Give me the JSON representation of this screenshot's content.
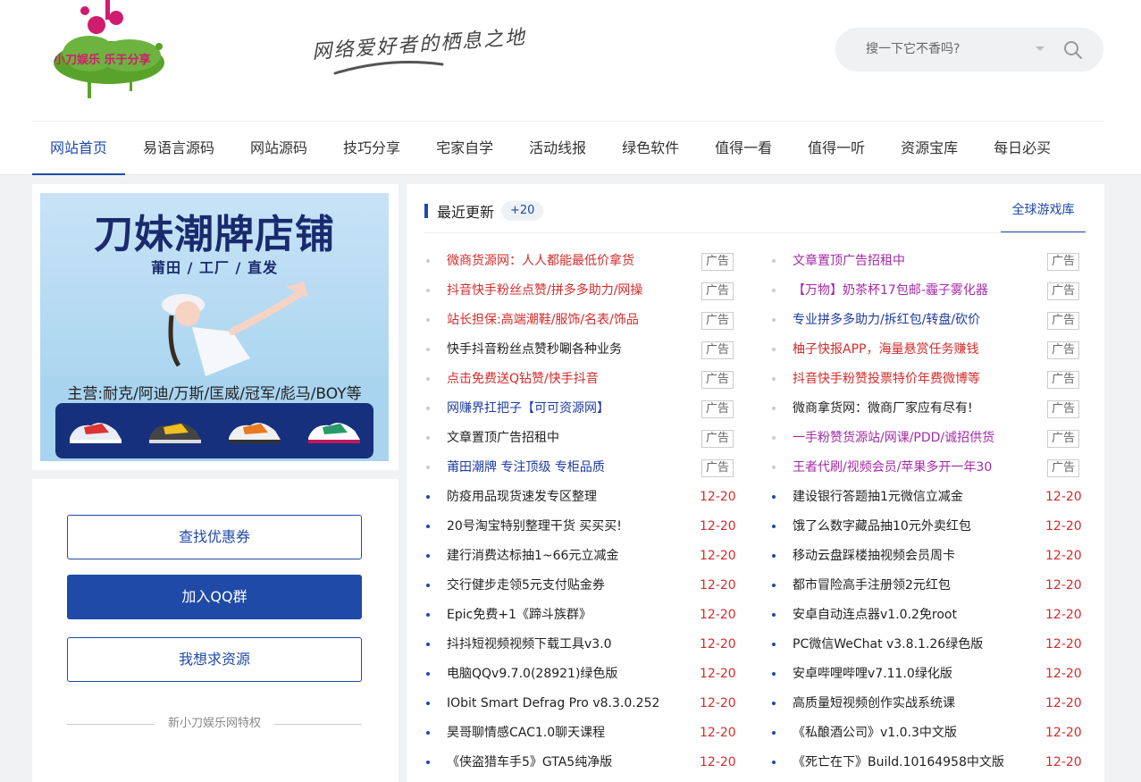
{
  "header": {
    "logo_text": "小刀娱乐 乐于分享",
    "slogan": "网络爱好者的栖息之地",
    "search_placeholder": "搜一下它不香吗?"
  },
  "nav": {
    "items": [
      "网站首页",
      "易语言源码",
      "网站源码",
      "技巧分享",
      "宅家自学",
      "活动线报",
      "绿色软件",
      "值得一看",
      "值得一听",
      "资源宝库",
      "每日必买"
    ],
    "active_index": 0
  },
  "ad": {
    "title": "刀妹潮牌店铺",
    "subtitle": "莆田 / 工厂 / 直发",
    "main_text": "主营:耐克/阿迪/万斯/匡威/冠军/彪马/BOY等"
  },
  "sidebar": {
    "buttons": [
      "查找优惠券",
      "加入QQ群",
      "我想求资源"
    ],
    "footer_text": "新小刀娱乐网特权"
  },
  "main": {
    "section_title": "最近更新",
    "badge": "+20",
    "right_tab": "全球游戏库",
    "ad_label": "广告",
    "left_ads": [
      {
        "text": "微商货源网：人人都能最低价拿货",
        "color": "red"
      },
      {
        "text": "抖音快手粉丝点赞/拼多多助力/网操",
        "color": "red"
      },
      {
        "text": "站长担保:高端潮鞋/服饰/名表/饰品",
        "color": "red"
      },
      {
        "text": "快手抖音粉丝点赞秒唰各种业务",
        "color": "dark"
      },
      {
        "text": "点击免费送Q钻赞/快手抖音",
        "color": "red"
      },
      {
        "text": "网赚界扛把子【可可资源网】",
        "color": "blue"
      },
      {
        "text": "文章置顶广告招租中",
        "color": "dark"
      },
      {
        "text": "莆田潮牌 专注顶级 专柜品质",
        "color": "blue"
      }
    ],
    "right_ads": [
      {
        "text": "文章置顶广告招租中",
        "color": "purple"
      },
      {
        "text": "【万物】奶茶杯17包邮-霾子雾化器",
        "color": "purple"
      },
      {
        "text": "专业拼多多助力/拆红包/转盘/砍价",
        "color": "blue"
      },
      {
        "text": "柚子快报APP，海量悬赏任务赚钱",
        "color": "red"
      },
      {
        "text": "抖音快手粉赞投票特价年费微博等",
        "color": "red"
      },
      {
        "text": "微商拿货网：微商厂家应有尽有!",
        "color": "dark"
      },
      {
        "text": "一手粉赞货源站/网课/PDD/诚招供货",
        "color": "purple"
      },
      {
        "text": "王者代刷/视频会员/苹果多开一年30",
        "color": "purple"
      }
    ],
    "left_news": [
      {
        "text": "防疫用品现货速发专区整理",
        "date": "12-20"
      },
      {
        "text": "20号淘宝特别整理干货 买买买!",
        "date": "12-20"
      },
      {
        "text": "建行消费达标抽1~66元立减金",
        "date": "12-20"
      },
      {
        "text": "交行健步走领5元支付贴金券",
        "date": "12-20"
      },
      {
        "text": "Epic免费+1《蹄斗族群》",
        "date": "12-20"
      },
      {
        "text": "抖抖短视频视频下载工具v3.0",
        "date": "12-20"
      },
      {
        "text": "电脑QQv9.7.0(28921)绿色版",
        "date": "12-20"
      },
      {
        "text": "IObit Smart Defrag Pro v8.3.0.252",
        "date": "12-20"
      },
      {
        "text": "昊哥聊情感CAC1.0聊天课程",
        "date": "12-20"
      },
      {
        "text": "《侠盗猎车手5》GTA5纯净版",
        "date": "12-20"
      }
    ],
    "right_news": [
      {
        "text": "建设银行答题抽1元微信立减金",
        "date": "12-20"
      },
      {
        "text": "饿了么数字藏品抽10元外卖红包",
        "date": "12-20"
      },
      {
        "text": "移动云盘踩楼抽视频会员周卡",
        "date": "12-20"
      },
      {
        "text": "都市冒险高手注册领2元红包",
        "date": "12-20"
      },
      {
        "text": "安卓自动连点器v1.0.2免root",
        "date": "12-20"
      },
      {
        "text": "PC微信WeChat v3.8.1.26绿色版",
        "date": "12-20"
      },
      {
        "text": "安卓哔哩哔哩v7.11.0绿化版",
        "date": "12-20"
      },
      {
        "text": "高质量短视频创作实战系统课",
        "date": "12-20"
      },
      {
        "text": "《私酿酒公司》v1.0.3中文版",
        "date": "12-20"
      },
      {
        "text": "《死亡在下》Build.10164958中文版",
        "date": "12-20"
      }
    ]
  },
  "colors": {
    "accent": "#1f4aa8",
    "red": "#d52b2b",
    "blue": "#1f3ca0",
    "purple": "#a42ba6",
    "dark": "#222222"
  }
}
